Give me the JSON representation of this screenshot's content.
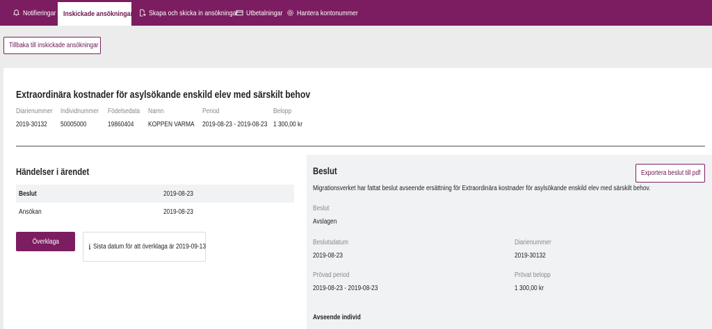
{
  "nav": {
    "tabs": [
      {
        "label": "Notifieringar",
        "icon": "bell-icon"
      },
      {
        "label": "Inskickade ansökningar",
        "icon": "document-icon",
        "active": true
      },
      {
        "label": "Skapa och skicka in ansökningar",
        "icon": "document-send-icon"
      },
      {
        "label": "Utbetalningar",
        "icon": "card-icon"
      },
      {
        "label": "Hantera kontonummer",
        "icon": "gear-icon"
      }
    ]
  },
  "back_button": "Tillbaka till inskickade ansökningar",
  "case": {
    "title": "Extraordinära kostnader för asylsökande enskild elev med särskilt behov",
    "fields": [
      {
        "label": "Diarienummer",
        "value": "2019-30132"
      },
      {
        "label": "Individnummer",
        "value": "50005000"
      },
      {
        "label": "Födelsedata",
        "value": "19860404"
      },
      {
        "label": "Namn",
        "value": "KOPPEN VARMA"
      },
      {
        "label": "Period",
        "value": "2019-08-23 - 2019-08-23"
      },
      {
        "label": "Belopp",
        "value": "1 300,00 kr"
      }
    ]
  },
  "events": {
    "heading": "Händelser i ärendet",
    "rows": [
      {
        "name": "Beslut",
        "date": "2019-08-23"
      },
      {
        "name": "Ansökan",
        "date": "2019-08-23"
      }
    ],
    "appeal_button": "Överklaga",
    "appeal_info": "Sista datum för att överklaga är 2019-09-13"
  },
  "decision": {
    "heading": "Beslut",
    "export_button": "Exportera beslut till pdf",
    "text": "Migrationsverket har fattat beslut avseende ersättning för Extraordinära kostnader för asylsökande enskild elev med särskilt behov.",
    "beslut_label": "Beslut",
    "beslut_value": "Avslagen",
    "beslutsdatum_label": "Beslutsdatum",
    "beslutsdatum_value": "2019-08-23",
    "diarienummer_label": "Diarienummer",
    "diarienummer_value": "2019-30132",
    "provad_period_label": "Prövad period",
    "provad_period_value": "2019-08-23 - 2019-08-23",
    "provat_belopp_label": "Prövat belopp",
    "provat_belopp_value": "1 300,00 kr",
    "individ_heading": "Avseende individ"
  },
  "colors": {
    "brand": "#7b1d60",
    "panel": "#f1f2f4",
    "page_bg": "#ececec"
  }
}
